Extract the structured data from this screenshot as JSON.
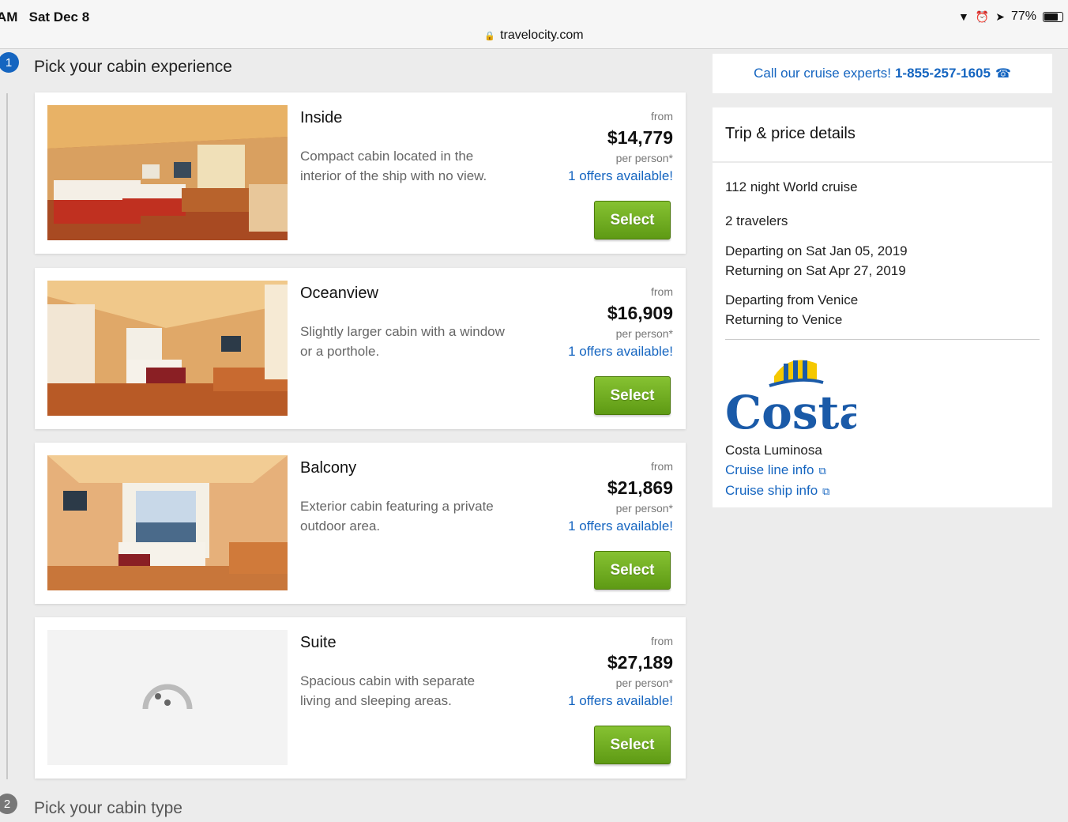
{
  "status_bar": {
    "time": "AM",
    "date": "Sat Dec 8",
    "battery": "77%",
    "battery_level": 0.77
  },
  "browser": {
    "url": "travelocity.com"
  },
  "steps": [
    {
      "number": "1",
      "title": "Pick your cabin experience"
    },
    {
      "number": "2",
      "title": "Pick your cabin type"
    }
  ],
  "cabins": [
    {
      "name": "Inside",
      "desc": "Compact cabin located in the interior of the ship with no view.",
      "from": "from",
      "price": "$14,779",
      "per": "per person*",
      "offers": "1 offers available!",
      "button": "Select"
    },
    {
      "name": "Oceanview",
      "desc": "Slightly larger cabin with a window or a porthole.",
      "from": "from",
      "price": "$16,909",
      "per": "per person*",
      "offers": "1 offers available!",
      "button": "Select"
    },
    {
      "name": "Balcony",
      "desc": "Exterior cabin featuring a private outdoor area.",
      "from": "from",
      "price": "$21,869",
      "per": "per person*",
      "offers": "1 offers available!",
      "button": "Select"
    },
    {
      "name": "Suite",
      "desc": "Spacious cabin with separate living and sleeping areas.",
      "from": "from",
      "price": "$27,189",
      "per": "per person*",
      "offers": "1 offers available!",
      "button": "Select"
    }
  ],
  "sidebar": {
    "call_text": "Call our cruise experts!",
    "phone": "1-855-257-1605",
    "trip_title": "Trip & price details",
    "cruise": "112 night World cruise",
    "travelers": "2 travelers",
    "departing_on": "Departing on Sat Jan 05, 2019",
    "returning_on": "Returning on Sat Apr 27, 2019",
    "departing_from": "Departing from Venice",
    "returning_to": "Returning to Venice",
    "logo_text": "Costa",
    "ship": "Costa Luminosa",
    "cruise_line_link": "Cruise line info",
    "cruise_ship_link": "Cruise ship info"
  },
  "colors": {
    "link": "#1565c0",
    "button": "#6aa81e",
    "step_active": "#1565c0",
    "costa_blue": "#1a5aa8",
    "costa_yellow": "#f5c800"
  }
}
